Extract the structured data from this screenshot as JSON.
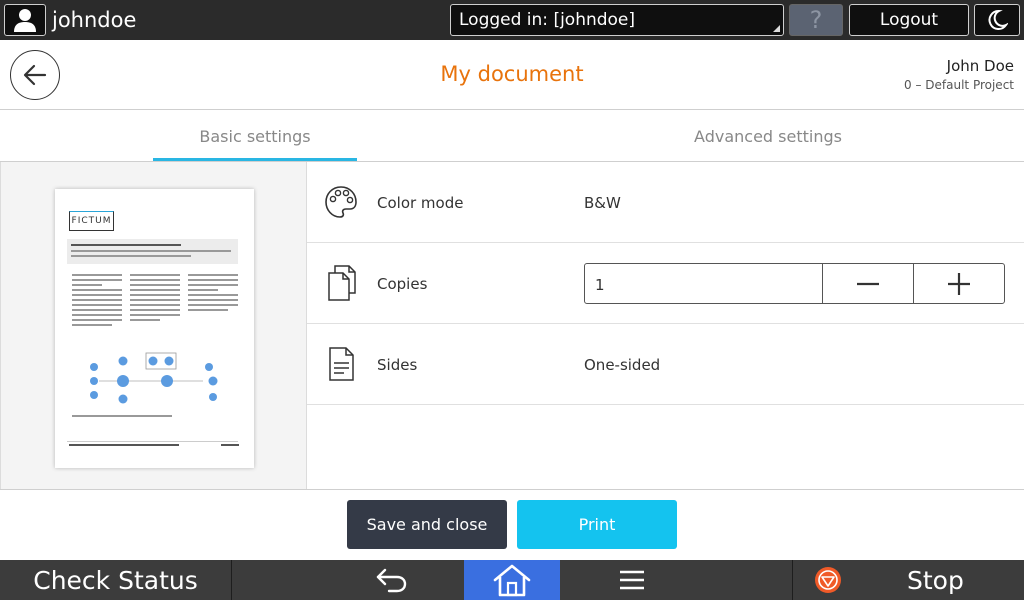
{
  "topbar": {
    "username": "johndoe",
    "login_status": "Logged in: [johndoe]",
    "help_label": "?",
    "logout_label": "Logout"
  },
  "header": {
    "title": "My document",
    "user_full_name": "John Doe",
    "project": "0 – Default Project"
  },
  "tabs": [
    {
      "label": "Basic settings",
      "active": true
    },
    {
      "label": "Advanced settings",
      "active": false
    }
  ],
  "preview": {
    "logo_text": "FICTUM"
  },
  "settings": {
    "color_mode": {
      "label": "Color mode",
      "value": "B&W",
      "icon": "palette-icon"
    },
    "copies": {
      "label": "Copies",
      "value": "1",
      "icon": "copies-icon"
    },
    "sides": {
      "label": "Sides",
      "value": "One-sided",
      "icon": "document-icon"
    }
  },
  "actions": {
    "save_label": "Save and close",
    "print_label": "Print"
  },
  "bottombar": {
    "check_status_label": "Check Status",
    "stop_label": "Stop"
  },
  "colors": {
    "accent_title": "#e8730c",
    "tab_underline": "#29b6e3",
    "print_button": "#14c3ef",
    "save_button": "#343a47",
    "home_button": "#3a6fe0",
    "stop_icon": "#f05a28"
  }
}
